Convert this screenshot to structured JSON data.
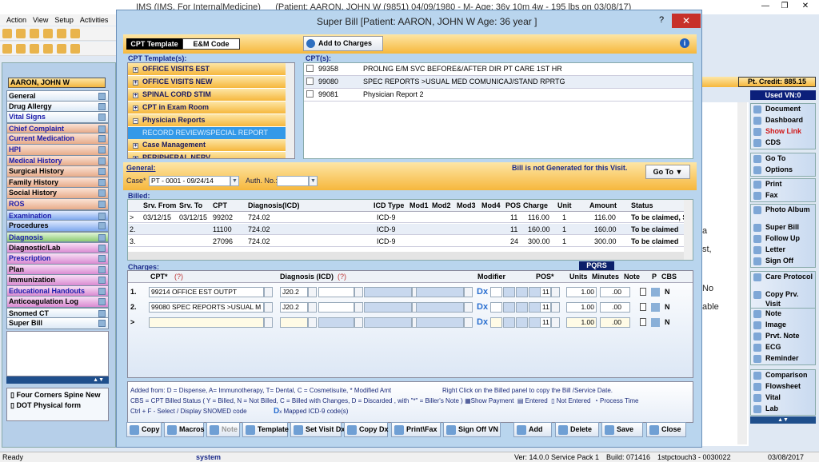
{
  "window": {
    "title": "IMS (IMS, For InternalMedicine)      (Patient: AARON, JOHN W (9851) 04/09/1980 - M- Age: 36y 10m 4w - 195 lbs on 03/08/17)",
    "minimize": "—",
    "restore": "❐",
    "close": "✕"
  },
  "menu": [
    "Action",
    "View",
    "Setup",
    "Activities"
  ],
  "patient": {
    "name": "AARON, JOHN W",
    "credit": "Pt. Credit: 885.15",
    "used_vn": "Used VN:0"
  },
  "nav": [
    {
      "label": "General",
      "style": "g0",
      "blue": false
    },
    {
      "label": "Drug Allergy",
      "style": "g0",
      "blue": false
    },
    {
      "label": "Vital Signs",
      "style": "g0",
      "blue": true
    },
    {
      "label": "Chief Complaint",
      "style": "g1",
      "blue": true
    },
    {
      "label": "Current Medication",
      "style": "g1",
      "blue": true
    },
    {
      "label": "HPI",
      "style": "g1",
      "blue": true
    },
    {
      "label": "Medical History",
      "style": "g1",
      "blue": true
    },
    {
      "label": "Surgical History",
      "style": "g1",
      "blue": false
    },
    {
      "label": "Family History",
      "style": "g1",
      "blue": false
    },
    {
      "label": "Social History",
      "style": "g1",
      "blue": false
    },
    {
      "label": "ROS",
      "style": "g1",
      "blue": true
    },
    {
      "label": "Examination",
      "style": "g2",
      "blue": true
    },
    {
      "label": "Procedures",
      "style": "g2",
      "blue": false
    },
    {
      "label": "Diagnosis",
      "style": "g3",
      "blue": true
    },
    {
      "label": "Diagnostic/Lab",
      "style": "g4",
      "blue": false
    },
    {
      "label": "Prescription",
      "style": "g4",
      "blue": true
    },
    {
      "label": "Plan",
      "style": "g4",
      "blue": false
    },
    {
      "label": "Immunization",
      "style": "g4",
      "blue": false
    },
    {
      "label": "Educational Handouts",
      "style": "g4",
      "blue": true
    },
    {
      "label": "Anticoagulation Log",
      "style": "g4",
      "blue": false
    },
    {
      "label": "Snomed CT",
      "style": "g0",
      "blue": false
    },
    {
      "label": "Super Bill",
      "style": "g0",
      "blue": false
    }
  ],
  "forms": [
    "Four Corners Spine New",
    "DOT Physical form"
  ],
  "dialog": {
    "title": "Super Bill [Patient: AARON, JOHN W Age: 36 year ]",
    "help": "?",
    "close": "✕",
    "tabs": [
      "CPT Template",
      "E&M Code"
    ],
    "add_to_charges": "Add to Charges",
    "cpt_templates_label": "CPT Template(s):",
    "templates": [
      {
        "label": "OFFICE VISITS EST",
        "sign": "+"
      },
      {
        "label": "OFFICE VISITS NEW",
        "sign": "+"
      },
      {
        "label": "SPINAL CORD STIM",
        "sign": "+"
      },
      {
        "label": "CPT in Exam Room",
        "sign": "+"
      },
      {
        "label": "Physician Reports",
        "sign": "−"
      }
    ],
    "template_child": "RECORD REVIEW/SPECIAL REPORT",
    "templates_after": [
      {
        "label": "Case Management",
        "sign": "+"
      },
      {
        "label": "PERIPHERAL NERV",
        "sign": "+"
      }
    ],
    "cpts_label": "CPT(s):",
    "cpts": [
      {
        "code": "99358",
        "desc": "PROLNG E/M SVC BEFORE&/AFTER DIR PT CARE 1ST HR"
      },
      {
        "code": "99080",
        "desc": "SPEC REPORTS >USUAL MED COMUNICAJ/STAND RPRTG"
      },
      {
        "code": "99081",
        "desc": "Physician Report 2"
      }
    ],
    "general": {
      "label": "General:",
      "case_label": "Case*",
      "case_value": "PT - 0001 - 09/24/14",
      "auth_label": "Auth. No.:",
      "auth_value": "",
      "bill_status": "Bill is not Generated for this Visit.",
      "goto": "Go To ▼"
    },
    "billed": {
      "label": "Billed:",
      "headers": [
        "",
        "Srv. From",
        "Srv. To",
        "CPT",
        "Diagnosis(ICD)",
        "ICD Type",
        "Mod1",
        "Mod2",
        "Mod3",
        "Mod4",
        "POS",
        "Charge",
        "Unit",
        "Amount",
        "Status"
      ],
      "rows": [
        [
          ">",
          "03/12/15",
          "03/12/15",
          "99202",
          "724.02",
          "ICD-9",
          "",
          "",
          "",
          "",
          "11",
          "116.00",
          "1",
          "116.00",
          "To be claimed, S"
        ],
        [
          "2.",
          "",
          "",
          "11100",
          "724.02",
          "ICD-9",
          "",
          "",
          "",
          "",
          "11",
          "160.00",
          "1",
          "160.00",
          "To be claimed"
        ],
        [
          "3.",
          "",
          "",
          "27096",
          "724.02",
          "ICD-9",
          "",
          "",
          "",
          "",
          "24",
          "300.00",
          "1",
          "300.00",
          "To be claimed"
        ]
      ]
    },
    "charges": {
      "label": "Charges:",
      "pqrs": "PQRS",
      "headers": {
        "cpt": "CPT*",
        "cpt_help": "(?)",
        "dx": "Diagnosis (ICD)",
        "dx_help": "(?)",
        "modifier": "Modifier",
        "pos": "POS*",
        "units": "Units",
        "minutes": "Minutes",
        "note": "Note",
        "p": "P",
        "cbs": "CBS"
      },
      "rows": [
        {
          "num": "1.",
          "cpt": "99214    OFFICE EST OUTPT",
          "dx1": "J20.2",
          "pos": "11",
          "units": "1.00",
          "minutes": ".00",
          "cbs": "N"
        },
        {
          "num": "2.",
          "cpt": "99080    SPEC REPORTS >USUAL M",
          "dx1": "J20.2",
          "pos": "11",
          "units": "1.00",
          "minutes": ".00",
          "cbs": "N"
        },
        {
          "num": ">",
          "cpt": "",
          "dx1": "",
          "pos": "11",
          "units": "1.00",
          "minutes": ".00",
          "cbs": "N"
        }
      ],
      "dx_btn": "Dx"
    },
    "legend": {
      "line1": "Added from: D = Dispense, A= Immunotherapy, T= Dental,  C = Cosmetisuite,   * Modified Amt",
      "line1b": "Right Click on the Billed panel to copy the Bill /Service Date.",
      "line2": "CBS = CPT Billed Status ( Y = Billed, N = Not Billed, C = Billed with Changes, D = Discarded , with \"*\" = Biller's Note )",
      "show_payment": "Show Payment",
      "entered": "Entered",
      "not_entered": "Not Entered",
      "process_time": "Process Time",
      "line3": "Ctrl + F - Select / Display SNOMED code",
      "mapped": "Mapped ICD-9 code(s)"
    },
    "buttons": [
      "Copy",
      "Macros",
      "Note",
      "Template",
      "Set Visit Dx",
      "Copy Dx",
      "Print\\Fax",
      "Sign Off VN",
      "Add",
      "Delete",
      "Save",
      "Close"
    ]
  },
  "background_fragments": [
    "a",
    "st,",
    "No",
    "able"
  ],
  "right_sidebar": [
    [
      "Document",
      "Dashboard",
      "Show Link",
      "CDS"
    ],
    [
      "Go To",
      "Options"
    ],
    [
      "Print",
      "Fax"
    ],
    [
      "Photo Album",
      "Super Bill",
      "Follow Up",
      "Letter",
      "Sign Off"
    ],
    [
      "Care Protocol",
      "Copy Prv. Visit"
    ],
    [
      "Note",
      "Image",
      "Prvt. Note",
      "ECG",
      "Reminder"
    ],
    [
      "Comparison",
      "Flowsheet",
      "Vital",
      "Lab"
    ]
  ],
  "status": {
    "ready": "Ready",
    "user": "system",
    "version": "Ver: 14.0.0 Service Pack 1",
    "build": "Build: 071416",
    "station": "1stpctouch3 - 0030022",
    "date": "03/08/2017"
  }
}
